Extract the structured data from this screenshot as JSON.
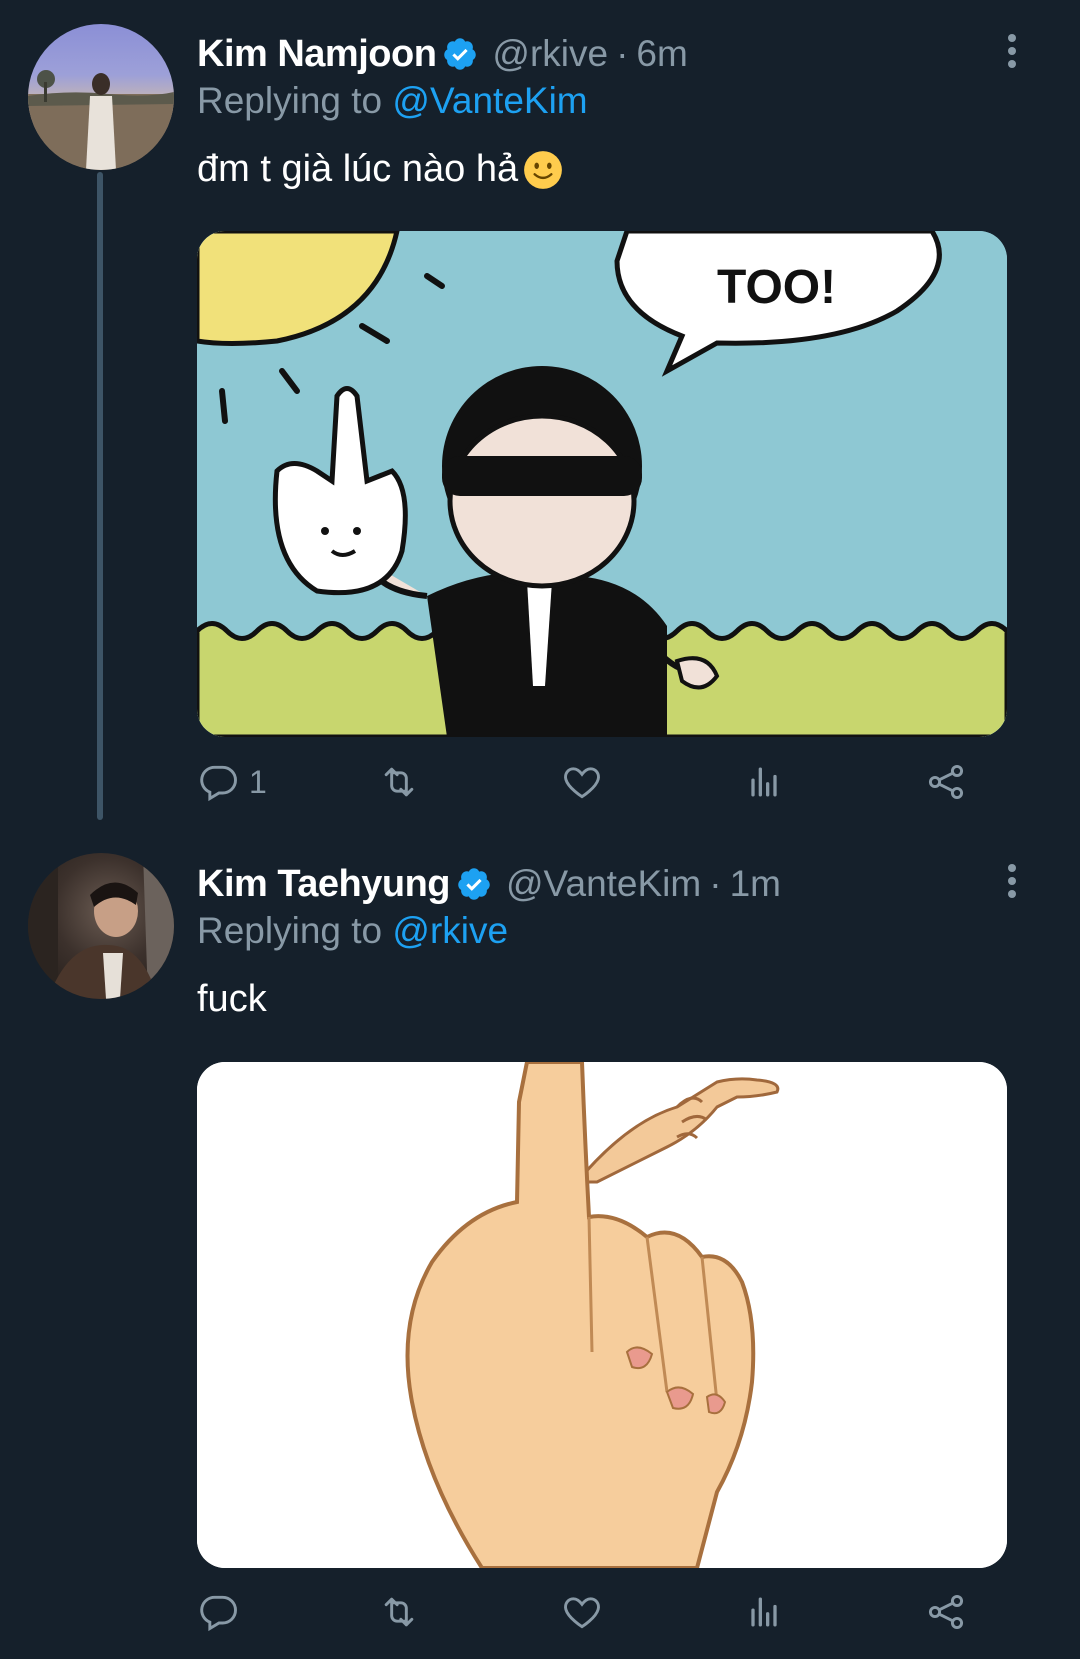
{
  "colors": {
    "background": "#15202b",
    "secondary_text": "#8899a6",
    "link": "#1da1f2",
    "verified": "#1da1f2"
  },
  "tweets": [
    {
      "name": "Kim Namjoon",
      "handle": "@rkive",
      "separator": "·",
      "time": "6m",
      "replying_prefix": "Replying to",
      "replying_to": "@VanteKim",
      "text": "đm t già lúc nào hả",
      "emoji": "slightly-smiling-face",
      "media_text": "TOO!",
      "actions": {
        "reply_count": "1",
        "retweet_count": "",
        "like_count": ""
      }
    },
    {
      "name": "Kim Taehyung",
      "handle": "@VanteKim",
      "separator": "·",
      "time": "1m",
      "replying_prefix": "Replying to",
      "replying_to": "@rkive",
      "text": "fuck",
      "actions": {
        "reply_count": "",
        "retweet_count": "",
        "like_count": ""
      }
    }
  ]
}
